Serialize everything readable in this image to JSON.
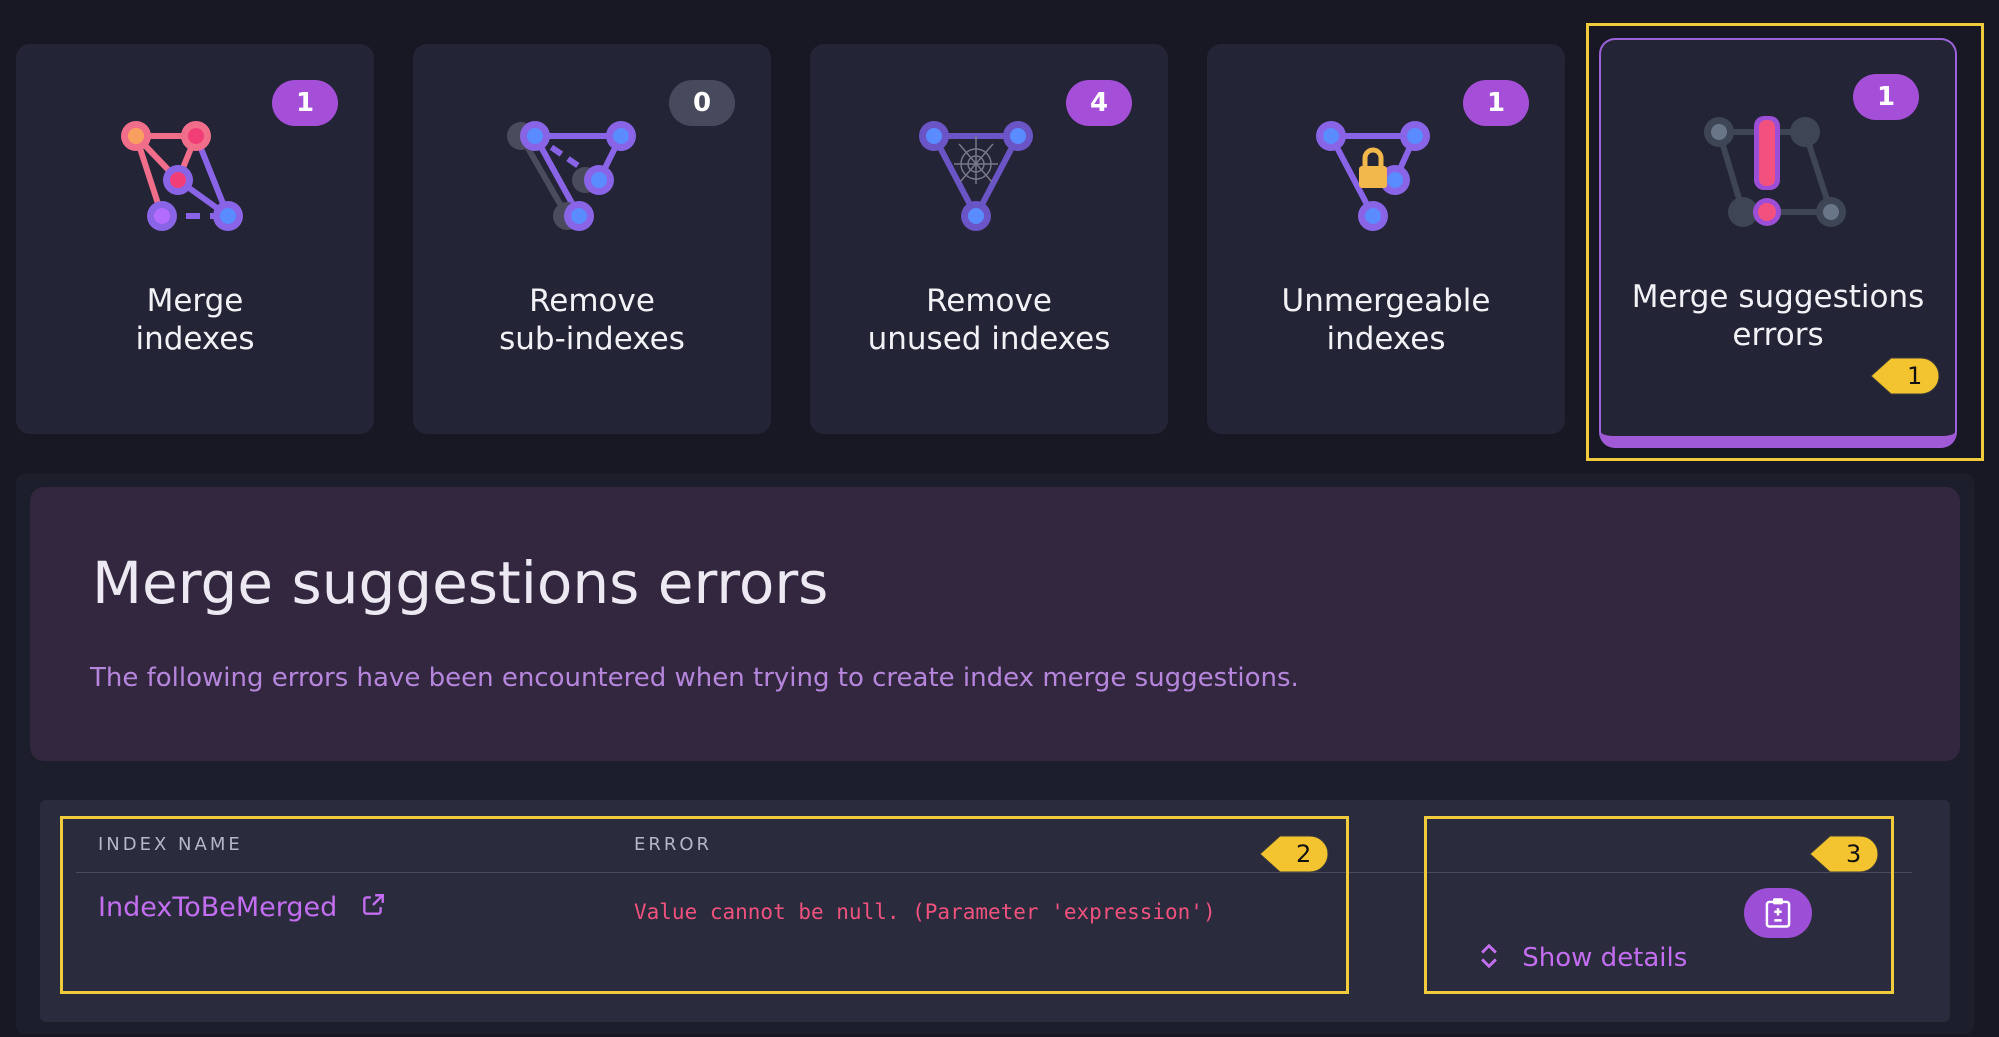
{
  "cards": [
    {
      "title": "Merge\nindexes",
      "count": "1"
    },
    {
      "title": "Remove\nsub-indexes",
      "count": "0"
    },
    {
      "title": "Remove\nunused indexes",
      "count": "4"
    },
    {
      "title": "Unmergeable\nindexes",
      "count": "1"
    },
    {
      "title": "Merge suggestions\nerrors",
      "count": "1"
    }
  ],
  "callouts": [
    "1",
    "2",
    "3"
  ],
  "section": {
    "title": "Merge suggestions errors",
    "description": "The following errors have been encountered when trying to create index merge suggestions."
  },
  "table": {
    "headers": [
      "INDEX NAME",
      "ERROR"
    ],
    "rows": [
      {
        "index_name": "IndexToBeMerged",
        "error": "Value cannot be null. (Parameter 'expression')"
      }
    ],
    "show_details_label": "Show details"
  },
  "icons": [
    "merge-graph-icon",
    "sub-index-graph-icon",
    "unused-graph-icon",
    "lock-graph-icon",
    "error-graph-icon",
    "external-link-icon",
    "clipboard-icon",
    "expand-icon"
  ],
  "colors": {
    "accent": "#a54fd9",
    "highlight": "#f0cb3c",
    "error": "#f0527e"
  }
}
